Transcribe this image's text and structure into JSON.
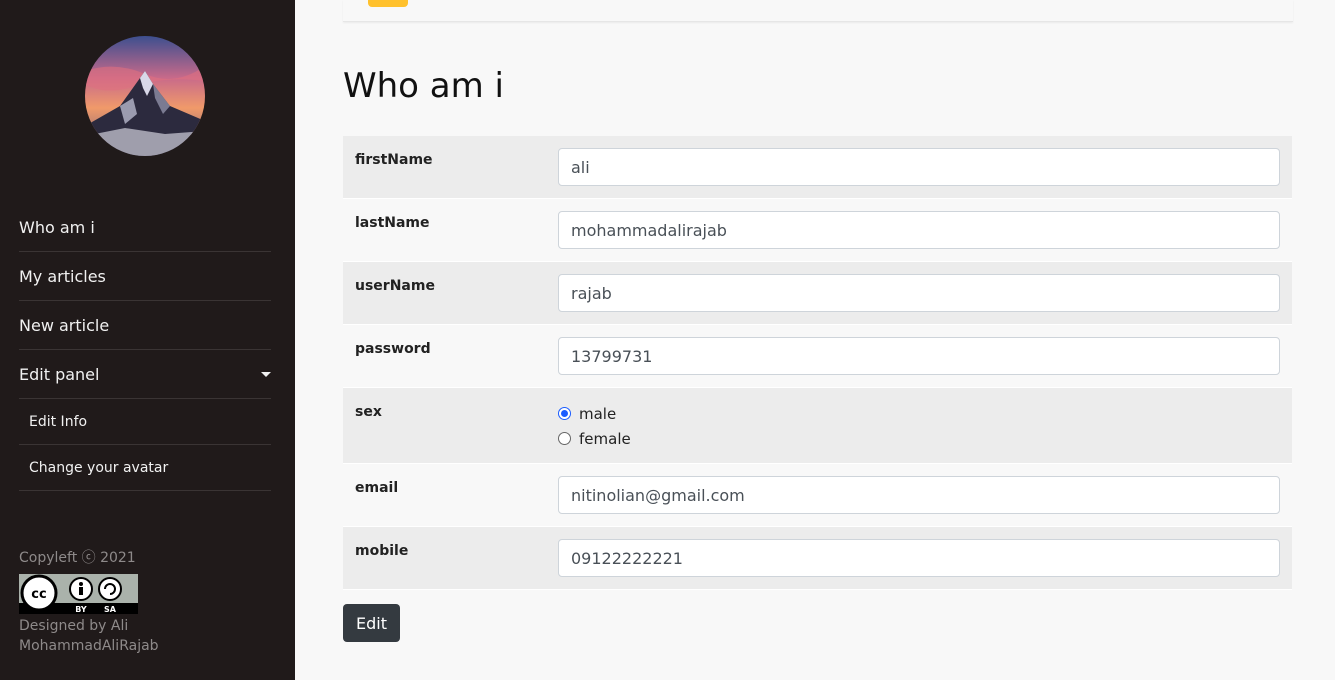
{
  "sidebar": {
    "nav": [
      {
        "label": "Who am i"
      },
      {
        "label": "My articles"
      },
      {
        "label": "New article"
      },
      {
        "label": "Edit panel"
      }
    ],
    "submenu": [
      {
        "label": "Edit Info"
      },
      {
        "label": "Change your avatar"
      }
    ],
    "footer": {
      "copyleft": "Copyleft ⓒ 2021",
      "designed_by": "Designed by Ali MohammadAliRajab",
      "license_badge": {
        "by": "BY",
        "sa": "SA"
      }
    }
  },
  "main": {
    "title": "Who am i",
    "fields": {
      "firstName": {
        "label": "firstName",
        "value": "ali"
      },
      "lastName": {
        "label": "lastName",
        "value": "mohammadalirajab"
      },
      "userName": {
        "label": "userName",
        "value": "rajab"
      },
      "password": {
        "label": "password",
        "value": "13799731"
      },
      "sex": {
        "label": "sex",
        "options": [
          "male",
          "female"
        ],
        "selected": "male"
      },
      "email": {
        "label": "email",
        "value": "nitinolian@gmail.com"
      },
      "mobile": {
        "label": "mobile",
        "value": "09122222221"
      }
    },
    "edit_label": "Edit"
  },
  "colors": {
    "sidebar_bg": "#201a1a",
    "accent": "#ffc12d",
    "button_bg": "#343a40",
    "radio_checked": "#1a5cff"
  }
}
